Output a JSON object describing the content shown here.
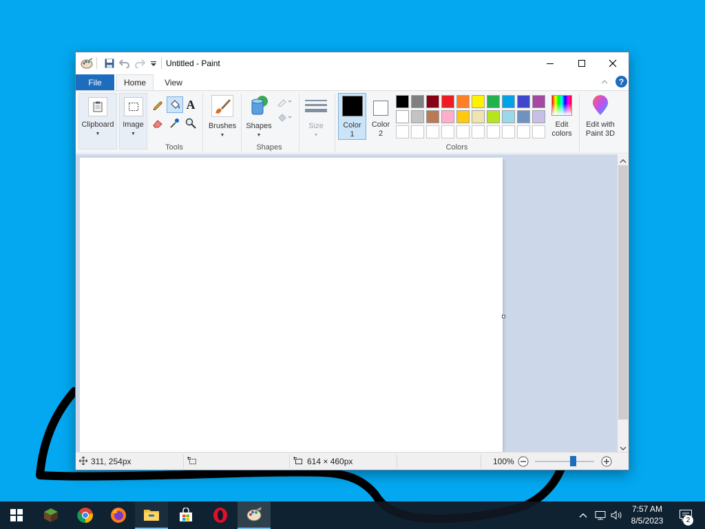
{
  "window": {
    "title": "Untitled - Paint",
    "minimize_icon": "minimize-icon",
    "maximize_icon": "maximize-icon",
    "close_icon": "close-icon"
  },
  "tabs": {
    "file": "File",
    "home": "Home",
    "view": "View"
  },
  "ribbon": {
    "clipboard_label": "Clipboard",
    "image_label": "Image",
    "tools_group": "Tools",
    "brushes_label": "Brushes",
    "shapes_label": "Shapes",
    "shapes_group": "Shapes",
    "size_label": "Size",
    "color1_label": "Color 1",
    "color2_label": "Color 2",
    "colors_group": "Colors",
    "edit_colors_label": "Edit colors",
    "paint3d_label": "Edit with Paint 3D",
    "color1_value": "#000000",
    "color2_value": "#ffffff"
  },
  "palette_row1": [
    "#000000",
    "#7f7f7f",
    "#880015",
    "#ed1c24",
    "#ff7f27",
    "#fff200",
    "#22b14c",
    "#00a2e8",
    "#3f48cc",
    "#a349a4"
  ],
  "palette_row2": [
    "#ffffff",
    "#c3c3c3",
    "#b97a57",
    "#ffaec9",
    "#ffc90e",
    "#efe4b0",
    "#b5e61d",
    "#99d9ea",
    "#7092be",
    "#c8bfe7"
  ],
  "status": {
    "cursor_pos": "311, 254px",
    "canvas_size": "614 × 460px",
    "zoom": "100%",
    "zoom_level": 1.0
  },
  "taskbar": {
    "time": "7:57 AM",
    "date": "8/5/2023",
    "notification_count": "2",
    "apps": [
      "minecraft-icon",
      "chrome-icon",
      "firefox-icon",
      "file-explorer-icon",
      "microsoft-store-icon",
      "opera-icon",
      "paint-icon"
    ]
  },
  "colors": {
    "accent": "#1e6cbe",
    "desktop": "#03a8f0",
    "selected_tool": "#cce4f7"
  }
}
